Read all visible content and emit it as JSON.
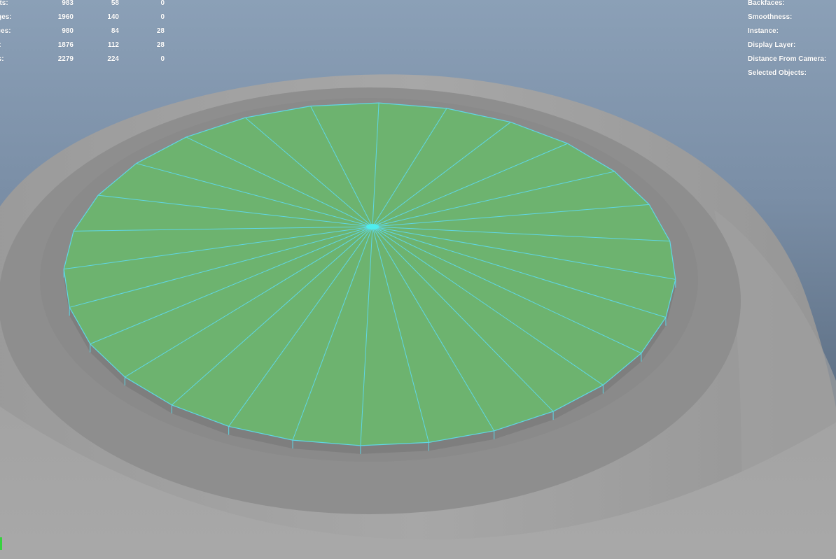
{
  "colors": {
    "background_top": "#8ba0b7",
    "background_bottom": "#4c5a6b",
    "mesh_gray": "#a3a3a3",
    "rim_gray": "#8c8c8c",
    "selected_face": "#6db36f",
    "edge_highlight": "#5fd7e6"
  },
  "hud_stats": [
    {
      "label": "erts:",
      "values": [
        "983",
        "58",
        "0"
      ]
    },
    {
      "label": "dges:",
      "values": [
        "1960",
        "140",
        "0"
      ]
    },
    {
      "label": "aces:",
      "values": [
        "980",
        "84",
        "28"
      ]
    },
    {
      "label": "is:",
      "values": [
        "1876",
        "112",
        "28"
      ]
    },
    {
      "label": "Vs:",
      "values": [
        "2279",
        "224",
        "0"
      ]
    }
  ],
  "hud_info": [
    {
      "label": "Backfaces:"
    },
    {
      "label": "Smoothness:"
    },
    {
      "label": "Instance:"
    },
    {
      "label": "Display Layer:"
    },
    {
      "label": "Distance From Camera:"
    },
    {
      "label": "Selected Objects:"
    }
  ],
  "selected_cap": {
    "segments": 28
  }
}
